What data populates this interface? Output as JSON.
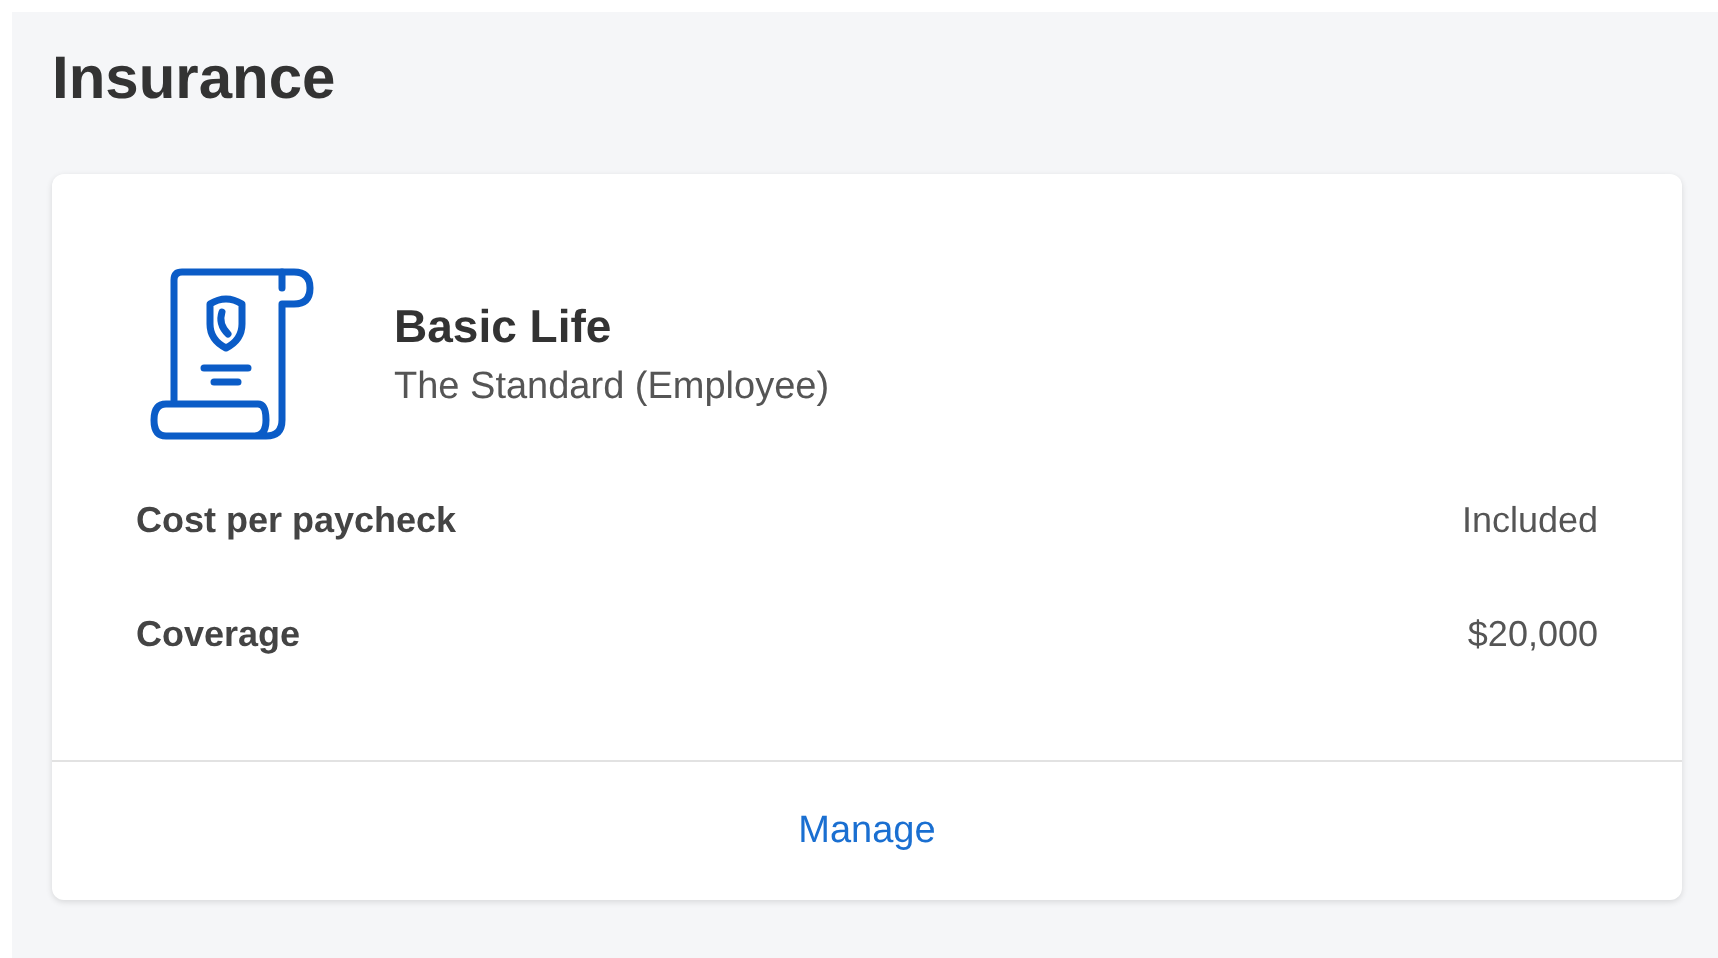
{
  "section": {
    "title": "Insurance"
  },
  "plan": {
    "name": "Basic Life",
    "provider": "The Standard (Employee)"
  },
  "details": [
    {
      "label": "Cost per paycheck",
      "value": "Included"
    },
    {
      "label": "Coverage",
      "value": "$20,000"
    }
  ],
  "action": {
    "label": "Manage"
  }
}
